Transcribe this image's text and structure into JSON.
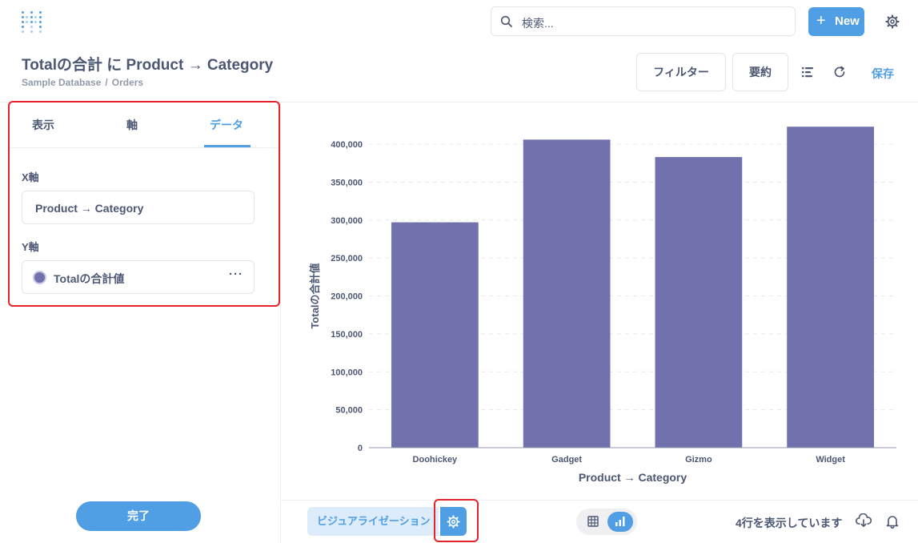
{
  "nav": {
    "search_placeholder": "検索...",
    "new_label": "New",
    "icons": [
      "metabase-logo-icon",
      "search-icon",
      "plus-icon",
      "gear-icon"
    ]
  },
  "question": {
    "title": "Totalの合計 に Product → Category",
    "breadcrumb": [
      "Sample Database",
      "Orders"
    ],
    "filter_label": "フィルター",
    "summarize_label": "要約",
    "save_label": "保存"
  },
  "sidebar": {
    "tabs": [
      {
        "label": "表示",
        "active": false
      },
      {
        "label": "軸",
        "active": false
      },
      {
        "label": "データ",
        "active": true
      }
    ],
    "x_axis_label": "X軸",
    "x_axis_field": "Product → Category",
    "y_axis_label": "Y軸",
    "y_axis_field": "Totalの合計値",
    "y_axis_more": "···",
    "done_label": "完了"
  },
  "chart_data": {
    "type": "bar",
    "categories": [
      "Doohickey",
      "Gadget",
      "Gizmo",
      "Widget"
    ],
    "series": [
      {
        "values": [
          297000,
          406000,
          383000,
          423000
        ]
      }
    ],
    "xlabel": "Product → Category",
    "ylabel": "Totalの合計値",
    "ylim": [
      0,
      400000
    ],
    "yticks": [
      "0",
      "50,000",
      "100,000",
      "150,000",
      "200,000",
      "250,000",
      "300,000",
      "350,000",
      "400,000"
    ],
    "bar_color": "#7172ad",
    "grid": true
  },
  "footer": {
    "viz_label": "ビジュアライゼーション",
    "row_count": "4行を表示しています"
  },
  "colors": {
    "brand": "#509ee3",
    "bar": "#7172ad",
    "text": "#4c5773",
    "annotation": "#e8222a"
  }
}
